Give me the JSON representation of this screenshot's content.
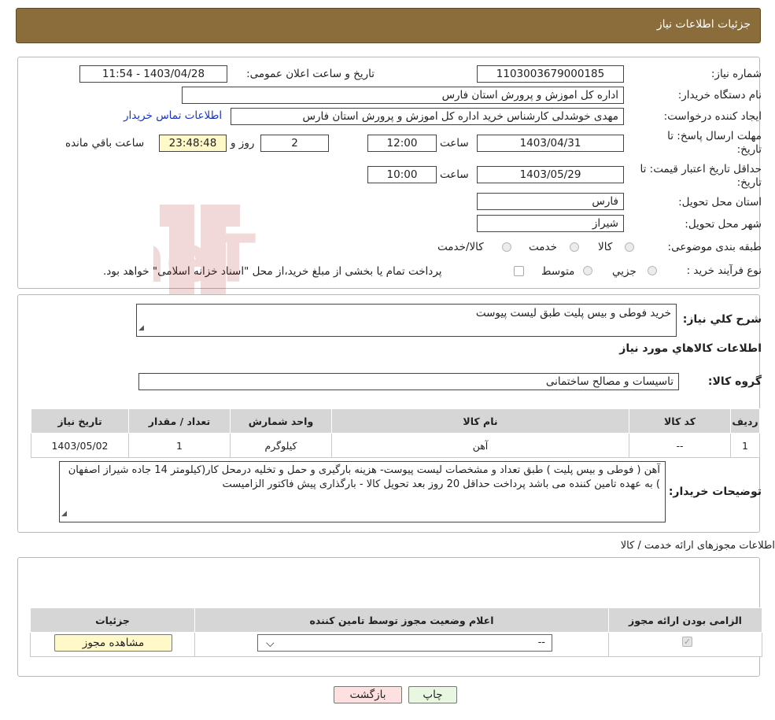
{
  "header": {
    "title": "جزئیات اطلاعات نیاز"
  },
  "fields": {
    "need_number_label": "شماره نیاز:",
    "need_number": "1103003679000185",
    "announce_label": "تاریخ و ساعت اعلان عمومی:",
    "announce_value": "1403/04/28 - 11:54",
    "buyer_org_label": "نام دستگاه خریدار:",
    "buyer_org": "اداره کل اموزش و پرورش استان فارس",
    "creator_label": "ایجاد کننده درخواست:",
    "creator": "مهدی خوشدلی کارشناس خرید اداره کل اموزش و پرورش استان فارس",
    "contact_link": "اطلاعات تماس خریدار",
    "deadline_label_1": "مهلت ارسال پاسخ: تا",
    "deadline_label_2": "تاریخ:",
    "deadline_date": "1403/04/31",
    "time_label": "ساعت",
    "deadline_time": "12:00",
    "days_value": "2",
    "days_label": "روز و",
    "remaining_time": "23:48:48",
    "remaining_label": "ساعت باقي مانده",
    "validity_label_1": "حداقل تاریخ اعتبار قیمت: تا",
    "validity_label_2": "تاریخ:",
    "validity_date": "1403/05/29",
    "validity_time_label": "ساعت",
    "validity_time": "10:00",
    "province_label": "استان محل تحویل:",
    "province": "فارس",
    "city_label": "شهر محل تحویل:",
    "city": "شیراز",
    "category_label": "طبقه بندی موضوعی:",
    "category_options": [
      "کالا",
      "خدمت",
      "کالا/خدمت"
    ],
    "process_label": "نوع فرآیند خرید :",
    "process_options": [
      "جزیي",
      "متوسط"
    ],
    "process_note": "پرداخت تمام یا بخشی از مبلغ خرید،از محل \"اسناد خزانه اسلامی\" خواهد بود."
  },
  "details": {
    "summary_label": "شرح کلي نياز:",
    "summary": "خرید فوطی و بیس پلیت طبق لیست پیوست",
    "goods_info_title": "اطلاعات کالاهاي مورد نياز",
    "group_label": "گروه کالا:",
    "group": "تاسیسات و مصالح ساختمانی",
    "table": {
      "headers": [
        "رديف",
        "کد کالا",
        "نام کالا",
        "واحد شمارش",
        "تعداد / مقدار",
        "تاريخ نياز"
      ],
      "rows": [
        [
          "1",
          "--",
          "آهن",
          "کیلوگرم",
          "1",
          "1403/05/02"
        ]
      ]
    },
    "buyer_notes_label": "توضیحات خریدار:",
    "buyer_notes": "آهن ( فوطی و بیس پلیت ) طبق تعداد و مشخصات لیست پیوست- هزینه بارگیری و حمل و تخلیه درمحل کار(کیلومتر 14 جاده شیراز اصفهان ) به عهده تامین کننده می باشد پرداخت حداقل 20 روز بعد تحویل کالا - بارگذاری پیش فاکتور الزامیست"
  },
  "permits": {
    "title": "اطلاعات مجوزهای ارائه خدمت / کالا",
    "headers": [
      "الزامی بودن ارائه مجوز",
      "اعلام وضعیت مجوز توسط تامین کننده",
      "جزئیات"
    ],
    "select_value": "--",
    "view_button": "مشاهده مجوز"
  },
  "buttons": {
    "print": "چاپ",
    "back": "بازگشت"
  },
  "watermark": {
    "text": "AriaTender.neT"
  },
  "colors": {
    "header_bg": "#8a6d3b",
    "link": "#1a33cc",
    "back_button": "#ffe0e0",
    "print_button": "#e8f7e0"
  }
}
